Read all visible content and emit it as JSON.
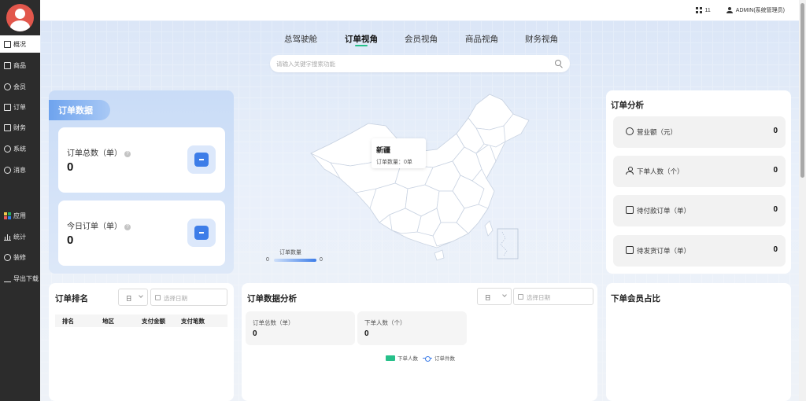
{
  "sidebar": {
    "items": [
      {
        "label": "概况",
        "icon": "dashboard-icon"
      },
      {
        "label": "商品",
        "icon": "goods-icon"
      },
      {
        "label": "会员",
        "icon": "member-icon"
      },
      {
        "label": "订单",
        "icon": "cart-icon"
      },
      {
        "label": "财务",
        "icon": "finance-icon"
      },
      {
        "label": "系统",
        "icon": "gear-icon"
      },
      {
        "label": "消息",
        "icon": "message-icon"
      },
      {
        "label": "应用",
        "icon": "apps-icon"
      },
      {
        "label": "统计",
        "icon": "stats-icon"
      },
      {
        "label": "装修",
        "icon": "brush-icon"
      },
      {
        "label": "导出下载",
        "icon": "download-icon"
      }
    ]
  },
  "topbar": {
    "count": "11",
    "user": "ADMIN(系统管理员)"
  },
  "tabs": [
    "总驾驶舱",
    "订单视角",
    "会员视角",
    "商品视角",
    "财务视角"
  ],
  "active_tab": "订单视角",
  "search": {
    "placeholder": "请输入关键字搜索功能"
  },
  "order_data": {
    "title": "订单数据",
    "total_label": "订单总数（单）",
    "total_value": "0",
    "today_label": "今日订单（单）",
    "today_value": "0"
  },
  "map": {
    "tooltip_region": "新疆",
    "tooltip_text": "订单数量：0单",
    "legend_title": "订单数量",
    "legend_min": "0",
    "legend_max": "0"
  },
  "analysis": {
    "title": "订单分析",
    "rows": [
      {
        "label": "营业额（元）",
        "value": "0",
        "icon": "coin-icon"
      },
      {
        "label": "下单人数（个）",
        "value": "0",
        "icon": "person-icon"
      },
      {
        "label": "待付款订单（单）",
        "value": "0",
        "icon": "wallet-icon"
      },
      {
        "label": "待发货订单（单）",
        "value": "0",
        "icon": "package-icon"
      }
    ]
  },
  "ranking": {
    "title": "订单排名",
    "period": "日",
    "date_placeholder": "选择日期",
    "columns": [
      "排名",
      "地区",
      "支付金额",
      "支付笔数"
    ]
  },
  "order_analysis": {
    "title": "订单数据分析",
    "period": "日",
    "date_placeholder": "选择日期",
    "total_label": "订单总数（单）",
    "total_value": "0",
    "buyers_label": "下单人数（个）",
    "buyers_value": "0",
    "legend_bar": "下单人数",
    "legend_line": "订单件数",
    "colors": {
      "bar": "#27c08a",
      "line": "#3d7de8"
    }
  },
  "member_ratio": {
    "title": "下单会员占比"
  }
}
